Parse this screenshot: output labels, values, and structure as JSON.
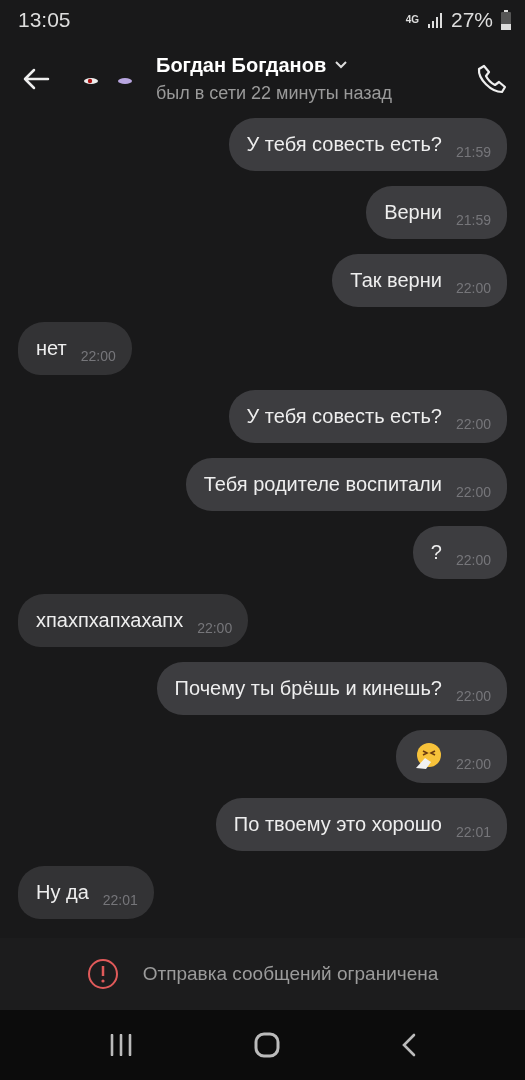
{
  "status_bar": {
    "time": "13:05",
    "network": "4G",
    "battery": "27%"
  },
  "header": {
    "name": "Богдан Богданов",
    "status": "был в сети 22 минуты назад"
  },
  "messages": [
    {
      "kind": "text",
      "outgoing": true,
      "text": "У тебя совесть есть?",
      "time": "21:59"
    },
    {
      "kind": "text",
      "outgoing": true,
      "text": "Верни",
      "time": "21:59"
    },
    {
      "kind": "text",
      "outgoing": true,
      "text": "Так верни",
      "time": "22:00"
    },
    {
      "kind": "text",
      "outgoing": false,
      "text": "нет",
      "time": "22:00"
    },
    {
      "kind": "text",
      "outgoing": true,
      "text": "У тебя совесть есть?",
      "time": "22:00"
    },
    {
      "kind": "text",
      "outgoing": true,
      "text": "Тебя родителе воспитали",
      "time": "22:00"
    },
    {
      "kind": "text",
      "outgoing": true,
      "text": "?",
      "time": "22:00"
    },
    {
      "kind": "text",
      "outgoing": false,
      "text": "хпахпхапхахапх",
      "time": "22:00"
    },
    {
      "kind": "text",
      "outgoing": true,
      "text": "Почему ты брёшь и кинешь?",
      "time": "22:00"
    },
    {
      "kind": "emoji",
      "outgoing": true,
      "time": "22:00"
    },
    {
      "kind": "text",
      "outgoing": true,
      "text": "По твоему это хорошо",
      "time": "22:01"
    },
    {
      "kind": "text",
      "outgoing": false,
      "text": "Ну да",
      "time": "22:01"
    }
  ],
  "notice": {
    "text": "Отправка сообщений ограничена"
  }
}
